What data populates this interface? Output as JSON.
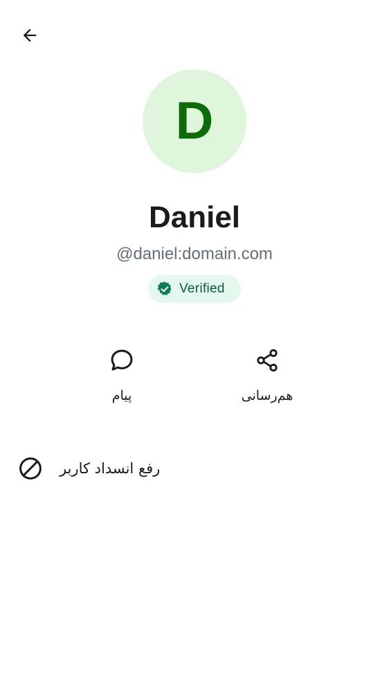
{
  "header": {
    "back_icon": "arrow-back-icon"
  },
  "profile": {
    "avatar_letter": "D",
    "avatar_bg": "#e0f6dc",
    "avatar_fg": "#0d6b07",
    "display_name": "Daniel",
    "user_id": "@daniel:domain.com",
    "verified_label": "Verified",
    "verified_icon": "verified-check-icon",
    "verified_color": "#0d7f55"
  },
  "actions": [
    {
      "label": "پیام",
      "icon": "chat-bubble-icon"
    },
    {
      "label": "هم‌رسانی",
      "icon": "share-icon"
    }
  ],
  "unblock": {
    "label": "رفع انسداد کاربر",
    "icon": "block-icon"
  }
}
